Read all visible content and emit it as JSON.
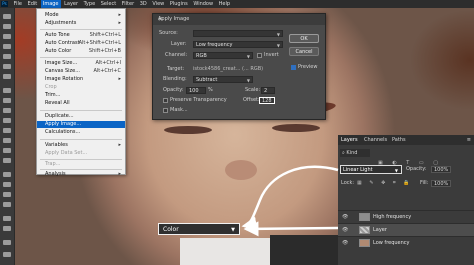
{
  "menubar": {
    "items": [
      "File",
      "Edit",
      "Image",
      "Layer",
      "Type",
      "Select",
      "Filter",
      "3D",
      "View",
      "Plugins",
      "Window",
      "Help"
    ],
    "active": "Image"
  },
  "image_menu": {
    "items": [
      {
        "label": "Mode",
        "shortcut": "",
        "disabled": false,
        "submenu": true
      },
      {
        "label": "Adjustments",
        "shortcut": "",
        "disabled": false,
        "submenu": true
      },
      {
        "label": "Auto Tone",
        "shortcut": "Shift+Ctrl+L",
        "disabled": false
      },
      {
        "label": "Auto Contrast",
        "shortcut": "Alt+Shift+Ctrl+L",
        "disabled": false
      },
      {
        "label": "Auto Color",
        "shortcut": "Shift+Ctrl+B",
        "disabled": false
      },
      {
        "label": "Image Size...",
        "shortcut": "Alt+Ctrl+I",
        "disabled": false
      },
      {
        "label": "Canvas Size...",
        "shortcut": "Alt+Ctrl+C",
        "disabled": false
      },
      {
        "label": "Image Rotation",
        "shortcut": "",
        "disabled": false,
        "submenu": true
      },
      {
        "label": "Crop",
        "shortcut": "",
        "disabled": true
      },
      {
        "label": "Trim...",
        "shortcut": "",
        "disabled": false
      },
      {
        "label": "Reveal All",
        "shortcut": "",
        "disabled": false
      },
      {
        "label": "Duplicate...",
        "shortcut": "",
        "disabled": false
      },
      {
        "label": "Apply Image...",
        "shortcut": "",
        "disabled": false,
        "selected": true
      },
      {
        "label": "Calculations...",
        "shortcut": "",
        "disabled": false
      },
      {
        "label": "Variables",
        "shortcut": "",
        "disabled": false,
        "submenu": true
      },
      {
        "label": "Apply Data Set...",
        "shortcut": "",
        "disabled": true
      },
      {
        "label": "Trap...",
        "shortcut": "",
        "disabled": true
      },
      {
        "label": "Analysis",
        "shortcut": "",
        "disabled": false,
        "submenu": true
      }
    ]
  },
  "dialog": {
    "title": "Apply Image",
    "source_label": "Source:",
    "source_value": "",
    "layer_label": "Layer:",
    "layer_value": "Low frequency",
    "channel_label": "Channel:",
    "channel_value": "RGB",
    "invert_label": "Invert",
    "target_label": "Target:",
    "target_value": "istock4586_creat... (... RGB)",
    "blending_label": "Blending:",
    "blending_value": "Subtract",
    "opacity_label": "Opacity:",
    "opacity_value": "100",
    "opacity_unit": "%",
    "scale_label": "Scale:",
    "scale_value": "2",
    "preserve_label": "Preserve Transparency",
    "offset_label": "Offset:",
    "offset_value": "128",
    "mask_label": "Mask...",
    "ok_label": "OK",
    "cancel_label": "Cancel",
    "preview_label": "Preview",
    "preview_checked": true
  },
  "layers_panel": {
    "tabs": [
      "Layers",
      "Channels",
      "Paths"
    ],
    "kind_label": "Kind",
    "blend_mode": "Linear Light",
    "opacity_label": "Opacity:",
    "opacity_value": "100%",
    "lock_label": "Lock:",
    "fill_label": "Fill:",
    "fill_value": "100%",
    "layers": [
      {
        "name": "High frequency",
        "selected": false
      },
      {
        "name": "Layer",
        "selected": true
      },
      {
        "name": "Low frequency",
        "selected": false
      }
    ]
  },
  "callout": {
    "blend_mode": "Color"
  },
  "colors": {
    "accent": "#0b64c5",
    "panel": "#3b3b3b",
    "dialog": "#4a4a4a"
  }
}
